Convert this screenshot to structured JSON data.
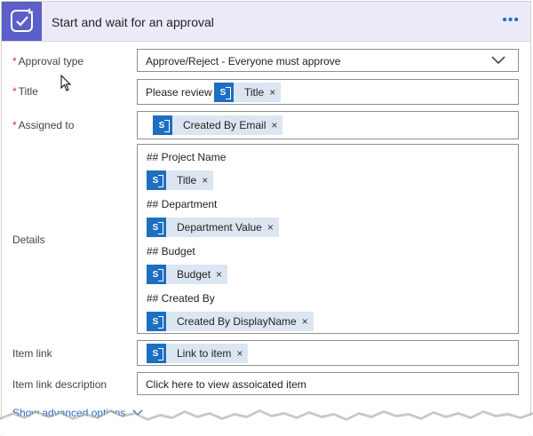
{
  "header": {
    "title": "Start and wait for an approval",
    "icon": "approval-check-icon",
    "more_label": "•••",
    "brand_color": "#5b5fc7"
  },
  "fields": {
    "approval_type": {
      "required_mark": "*",
      "label": "Approval type",
      "value": "Approve/Reject - Everyone must approve"
    },
    "title": {
      "required_mark": "*",
      "label": "Title",
      "prefix": "Please review",
      "token": {
        "label": "Title",
        "remove": "×"
      }
    },
    "assigned_to": {
      "required_mark": "*",
      "label": "Assigned to",
      "token": {
        "label": "Created By Email",
        "remove": "×"
      }
    },
    "details": {
      "label": "Details",
      "sections": [
        {
          "heading": "## Project Name",
          "token": {
            "label": "Title",
            "remove": "×"
          }
        },
        {
          "heading": "## Department",
          "token": {
            "label": "Department Value",
            "remove": "×"
          }
        },
        {
          "heading": "## Budget",
          "token": {
            "label": "Budget",
            "remove": "×"
          }
        },
        {
          "heading": "## Created By",
          "token": {
            "label": "Created By DisplayName",
            "remove": "×"
          }
        }
      ]
    },
    "item_link": {
      "label": "Item link",
      "token": {
        "label": "Link to item",
        "remove": "×"
      }
    },
    "item_link_description": {
      "label": "Item link description",
      "value": "Click here to view assoicated item"
    }
  },
  "advanced": {
    "label": "Show advanced options"
  },
  "token_icon": "sharepoint-icon",
  "token_color": "#1d6fbf"
}
